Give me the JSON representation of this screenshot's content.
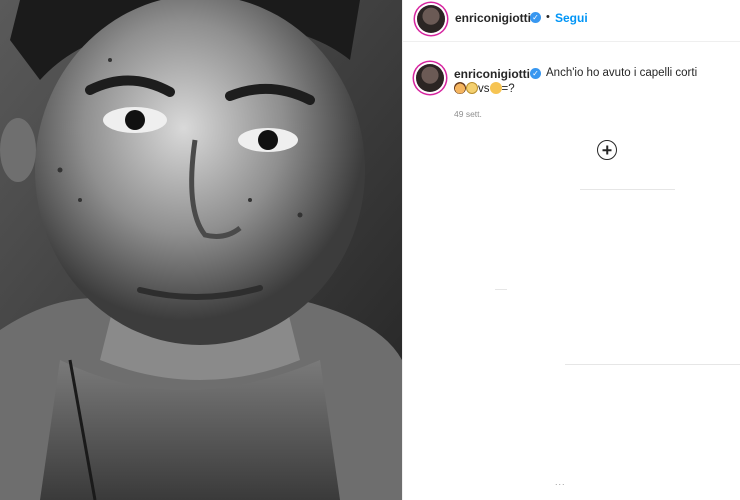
{
  "header": {
    "username": "enriconigiotti",
    "verified_icon": "verified-badge-icon",
    "separator": "•",
    "follow_label": "Segui"
  },
  "caption": {
    "username": "enriconigiotti",
    "text": "Anch'io ho avuto i capelli corti",
    "emoji_line_mid": "vs",
    "emoji_line_end": "=?",
    "time": "49 sett."
  },
  "footer": {
    "ellipsis": "..."
  },
  "colors": {
    "accent": "#0095f6",
    "verified": "#3897f0",
    "story_ring": "#d6249f",
    "text": "#262626",
    "muted": "#8e8e8e"
  },
  "icons": {
    "load_more": "plus-circle-icon"
  }
}
